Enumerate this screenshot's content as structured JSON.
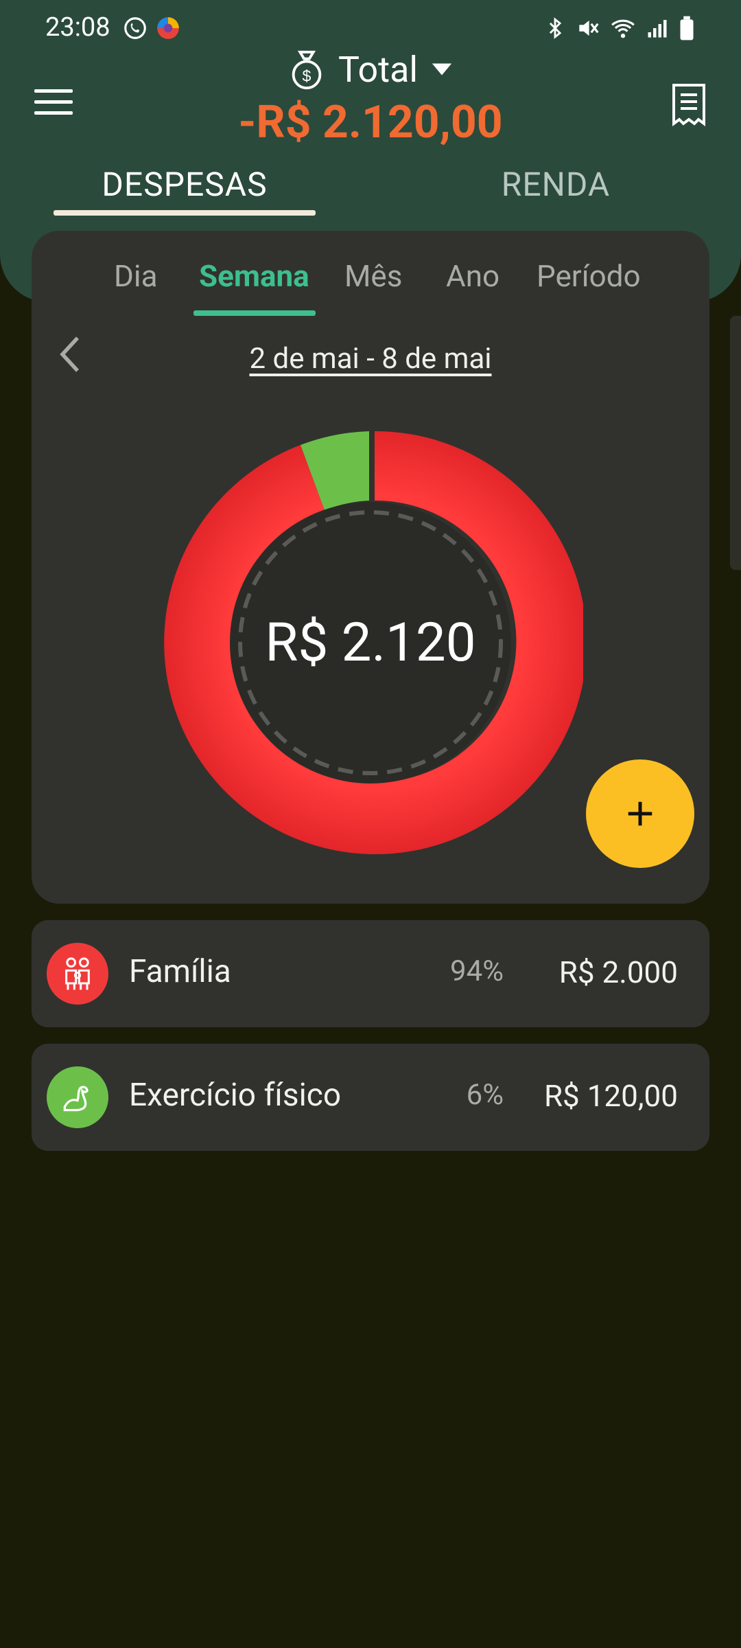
{
  "status": {
    "time": "23:08"
  },
  "header": {
    "account_label": "Total",
    "total_amount": "-R$ 2.120,00",
    "tabs": [
      "DESPESAS",
      "RENDA"
    ],
    "active_tab": "DESPESAS"
  },
  "card": {
    "periods": [
      "Dia",
      "Semana",
      "Mês",
      "Ano",
      "Período"
    ],
    "active_period": "Semana",
    "date_range": "2 de mai - 8 de mai",
    "center_total": "R$ 2.120"
  },
  "categories": [
    {
      "name": "Família",
      "percent": "94%",
      "amount": "R$ 2.000",
      "color": "#f03a3a",
      "icon": "family-icon"
    },
    {
      "name": "Exercício físico",
      "percent": "6%",
      "amount": "R$ 120,00",
      "color": "#6cc04a",
      "icon": "muscle-arm-icon"
    }
  ],
  "colors": {
    "header": "#2a4a3c",
    "accent": "#3dbf8e",
    "fab": "#fbbf24",
    "expense": "#f06a32"
  }
}
